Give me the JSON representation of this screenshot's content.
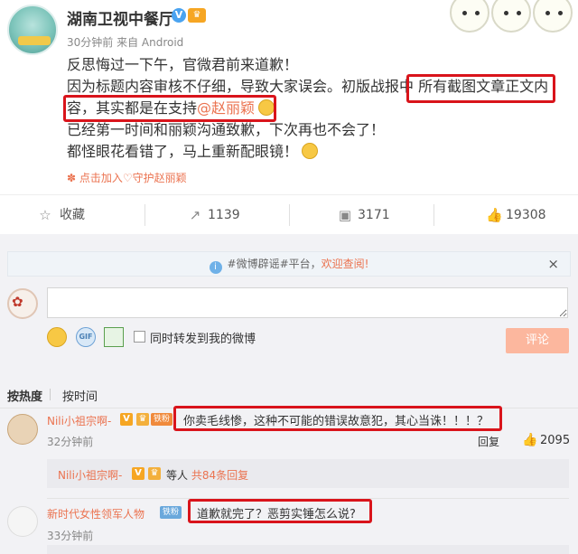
{
  "post": {
    "account_name": "湖南卫视中餐厅",
    "meta": "30分钟前 来自 Android",
    "lines": [
      "反思悔过一下午，官微君前来道歉！",
      "因为标题内容审核不仔细，导致大家误会。初版战报中 所有截图文章正文内",
      "容，其实都是在支持",
      "已经第一时间和丽颖沟通致歉，下次再也不会了！",
      "都怪眼花看错了，马上重新配眼镜！"
    ],
    "mention": "@赵丽颖",
    "join_link": "点击加入♡守护赵丽颖",
    "highlight_color": "#d9141b",
    "accent_color": "#eb7350"
  },
  "actions": {
    "favorite": "收藏",
    "forward": "1139",
    "comment": "3171",
    "like": "19308"
  },
  "notice": {
    "prefix": "#微博辟谣#平台，",
    "link": "欢迎查阅!",
    "close": "×"
  },
  "composer": {
    "placeholder": "",
    "forward_label": "同时转发到我的微博",
    "submit": "评论"
  },
  "sort": {
    "hot": "按热度",
    "time": "按时间"
  },
  "comments": [
    {
      "name": "Nili小祖宗啊-",
      "badge": "铁粉",
      "text": "你卖毛线惨，这种不可能的错误故意犯，其心当诛！！！？",
      "time": "32分钟前",
      "reply": "回复",
      "likes": "2095",
      "subreply": {
        "name": "Nili小祖宗啊-",
        "middle": "等人",
        "link": "共84条回复"
      }
    },
    {
      "name": "新时代女性领军人物",
      "badge": "铁粉",
      "text": "道歉就完了？恶剪实锤怎么说?",
      "time": "33分钟前"
    }
  ]
}
